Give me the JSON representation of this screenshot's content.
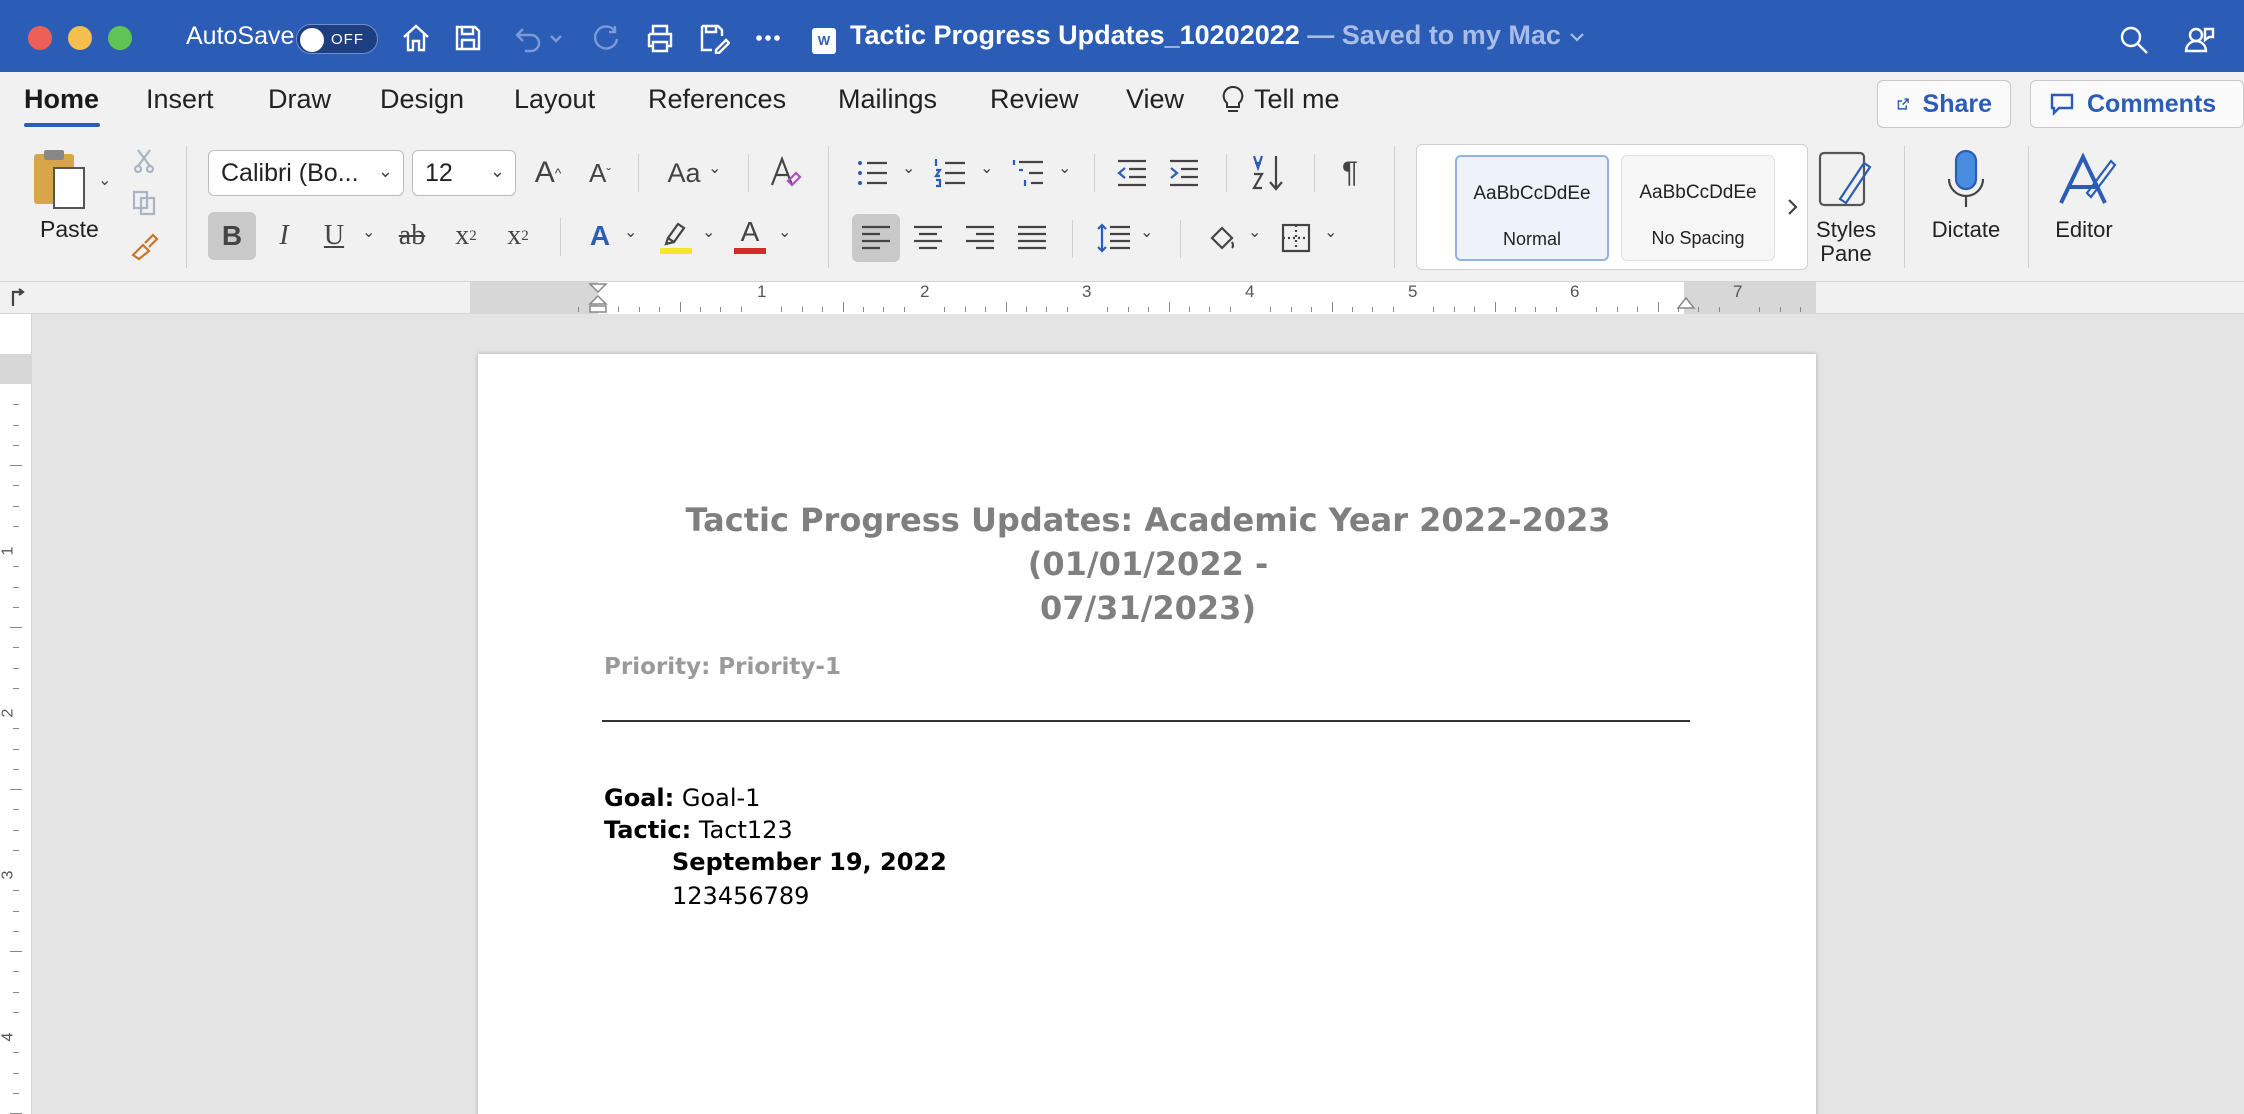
{
  "titlebar": {
    "autosave_label": "AutoSave",
    "autosave_state": "OFF",
    "doc_name": "Tactic Progress Updates_10202022",
    "save_status": " — Saved to my Mac",
    "word_badge": "W"
  },
  "tabs": [
    {
      "label": "Home"
    },
    {
      "label": "Insert"
    },
    {
      "label": "Draw"
    },
    {
      "label": "Design"
    },
    {
      "label": "Layout"
    },
    {
      "label": "References"
    },
    {
      "label": "Mailings"
    },
    {
      "label": "Review"
    },
    {
      "label": "View"
    },
    {
      "label": "Tell me"
    }
  ],
  "actions": {
    "share": "Share",
    "comments": "Comments"
  },
  "ribbon": {
    "paste": "Paste",
    "font_name": "Calibri (Bo...",
    "font_size": "12",
    "bold": "B",
    "italic": "I",
    "underline": "U",
    "strike": "ab",
    "subscript": "x",
    "subscript_mark": "2",
    "superscript": "x",
    "superscript_mark": "2",
    "change_case": "Aa",
    "grow_font": "A",
    "shrink_font": "A",
    "text_effects": "A",
    "font_color": "A",
    "pilcrow": "¶",
    "style_normal_preview": "AaBbCcDdEe",
    "style_normal_name": "Normal",
    "style_nospacing_preview": "AaBbCcDdEe",
    "style_nospacing_name": "No Spacing",
    "styles_pane_line1": "Styles",
    "styles_pane_line2": "Pane",
    "dictate": "Dictate",
    "editor": "Editor"
  },
  "ruler": {
    "numbers": [
      "1",
      "2",
      "3",
      "4",
      "5",
      "6",
      "7"
    ]
  },
  "vruler": {
    "numbers": [
      "1",
      "2",
      "3",
      "4"
    ]
  },
  "document": {
    "heading_line1": "Tactic Progress Updates: Academic Year 2022-2023 (01/01/2022 -",
    "heading_line2": "07/31/2023)",
    "priority": "Priority: Priority-1",
    "goal_label": "Goal:",
    "goal_value": " Goal-1",
    "tactic_label": "Tactic:",
    "tactic_value": " Tact123",
    "entry_date": "September 19, 2022",
    "entry_text": "123456789"
  },
  "colors": {
    "titlebar": "#2b5cb6",
    "heading_gray": "#7f7f7f",
    "accent_blue": "#2b5cb6",
    "highlight_yellow": "#f5e52c",
    "font_red": "#d42a2a"
  }
}
